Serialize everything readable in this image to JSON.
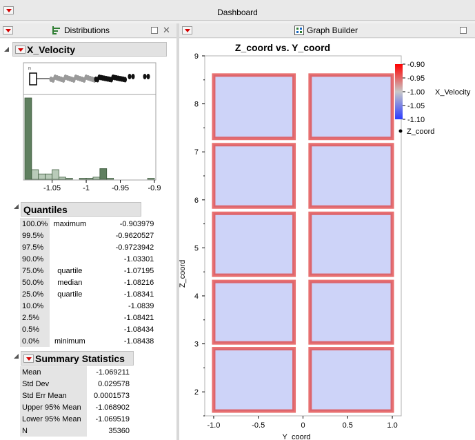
{
  "window": {
    "title": "Dashboard"
  },
  "distributions_panel": {
    "header": "Distributions",
    "variable": "X_Velocity",
    "histogram": {
      "x_ticks": [
        "-1.05",
        "-1",
        "-0.95",
        "-0.9"
      ],
      "bin_edges": [
        -1.09,
        -1.08,
        -1.07,
        -1.06,
        -1.05,
        -1.04,
        -1.03,
        -1.02,
        -1.01,
        -1.0,
        -0.99,
        -0.98,
        -0.97,
        -0.96,
        -0.95,
        -0.94,
        -0.93,
        -0.92,
        -0.91,
        -0.9
      ],
      "relative_heights": [
        0.76,
        0.09,
        0.05,
        0.05,
        0.09,
        0.02,
        0.01,
        0.0,
        0.01,
        0.01,
        0.02,
        0.1,
        0.01,
        0.0,
        0.0,
        0.0,
        0.0,
        0.0,
        0.01
      ],
      "highlighted_bins": [
        0,
        11
      ]
    },
    "quantiles": {
      "title": "Quantiles",
      "rows": [
        {
          "pct": "100.0%",
          "label": "maximum",
          "value": "-0.903979"
        },
        {
          "pct": "99.5%",
          "label": "",
          "value": "-0.9620527"
        },
        {
          "pct": "97.5%",
          "label": "",
          "value": "-0.9723942"
        },
        {
          "pct": "90.0%",
          "label": "",
          "value": "-1.03301"
        },
        {
          "pct": "75.0%",
          "label": "quartile",
          "value": "-1.07195"
        },
        {
          "pct": "50.0%",
          "label": "median",
          "value": "-1.08216"
        },
        {
          "pct": "25.0%",
          "label": "quartile",
          "value": "-1.08341"
        },
        {
          "pct": "10.0%",
          "label": "",
          "value": "-1.0839"
        },
        {
          "pct": "2.5%",
          "label": "",
          "value": "-1.08421"
        },
        {
          "pct": "0.5%",
          "label": "",
          "value": "-1.08434"
        },
        {
          "pct": "0.0%",
          "label": "minimum",
          "value": "-1.08438"
        }
      ]
    },
    "summary": {
      "title": "Summary Statistics",
      "rows": [
        {
          "label": "Mean",
          "value": "-1.069211"
        },
        {
          "label": "Std Dev",
          "value": "0.029578"
        },
        {
          "label": "Std Err Mean",
          "value": "0.0001573"
        },
        {
          "label": "Upper 95% Mean",
          "value": "-1.068902"
        },
        {
          "label": "Lower 95% Mean",
          "value": "-1.069519"
        },
        {
          "label": "N",
          "value": "35360"
        }
      ]
    }
  },
  "graph_builder_panel": {
    "header": "Graph Builder",
    "chart_data": {
      "type": "heatmap",
      "title": "Z_coord vs. Y_coord",
      "xlabel": "Y_coord",
      "ylabel": "Z_coord",
      "xlim": [
        -1.1,
        1.1
      ],
      "ylim": [
        1.5,
        9.0
      ],
      "x_ticks": [
        "-1.0",
        "-0.5",
        "0",
        "0.5",
        "1.0"
      ],
      "y_ticks": [
        "2",
        "3",
        "4",
        "5",
        "6",
        "7",
        "8",
        "9"
      ],
      "cells_y_ranges": [
        [
          -1.0,
          -0.1
        ],
        [
          0.08,
          1.0
        ]
      ],
      "cells_z_ranges": [
        [
          1.6,
          2.9
        ],
        [
          3.02,
          4.3
        ],
        [
          4.43,
          5.72
        ],
        [
          5.85,
          7.15
        ],
        [
          7.28,
          8.6
        ]
      ],
      "interior_value": -1.07,
      "edge_value": -0.9,
      "color_scale": {
        "title": "X_Velocity",
        "ticks": [
          "-0.90",
          "-0.95",
          "-1.00",
          "-1.05",
          "-1.10"
        ],
        "min": -1.1,
        "max": -0.9,
        "colors": [
          "#2b3cff",
          "#c8c8c8",
          "#ff0000"
        ]
      },
      "legend": {
        "marker_label": "Z_coord",
        "position": "right"
      }
    }
  }
}
